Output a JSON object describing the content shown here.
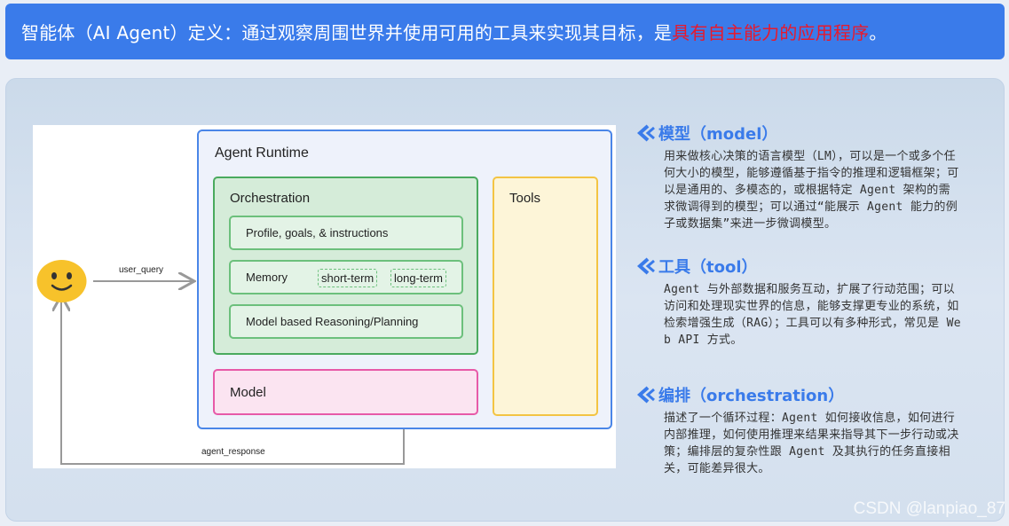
{
  "header": {
    "text_main": "智能体（AI Agent）定义：通过观察周围世界并使用可用的工具来实现其目标，是",
    "text_highlight": "具有自主能力的应用程序",
    "text_end": "。"
  },
  "diagram": {
    "runtime_title": "Agent Runtime",
    "orchestration_title": "Orchestration",
    "items": {
      "profile": "Profile, goals, & instructions",
      "memory": "Memory",
      "memory_short": "short-term",
      "memory_long": "long-term",
      "reasoning": "Model based Reasoning/Planning"
    },
    "model_label": "Model",
    "tools_label": "Tools",
    "user_query_label": "user_query",
    "agent_response_label": "agent_response",
    "colors": {
      "runtime_border": "#4a86e8",
      "orchestration_border": "#4aaa5e",
      "model_border": "#e75aa8",
      "tools_border": "#f3c443"
    }
  },
  "sections": [
    {
      "title": "模型（model）",
      "body": "用来做核心决策的语言模型（LM），可以是一个或多个任何大小的模型，能够遵循基于指令的推理和逻辑框架；可以是通用的、多模态的，或根据特定 Agent 架构的需求微调得到的模型；可以通过“能展示 Agent 能力的例子或数据集”来进一步微调模型。"
    },
    {
      "title": "工具（tool）",
      "body": "Agent 与外部数据和服务互动，扩展了行动范围；可以访问和处理现实世界的信息，能够支撑更专业的系统，如检索增强生成（RAG）；工具可以有多种形式，常见是 Web API 方式。"
    },
    {
      "title": "编排（orchestration）",
      "body": "描述了一个循环过程：Agent 如何接收信息，如何进行内部推理，如何使用推理来结果来指导其下一步行动或决策；编排层的复杂性跟 Agent 及其执行的任务直接相关，可能差异很大。"
    }
  ],
  "watermark": "CSDN @lanpiao_87",
  "icons": {
    "section": "chevron-left-icon",
    "user": "smiley-face-icon"
  }
}
